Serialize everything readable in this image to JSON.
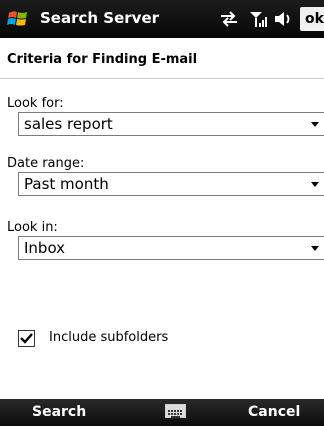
{
  "titlebar": {
    "app_title": "Search Server",
    "ok_label": "ok",
    "icons": [
      "windows-logo",
      "data-connection",
      "signal-strength",
      "speaker"
    ]
  },
  "header": {
    "title": "Criteria for Finding E-mail"
  },
  "form": {
    "look_for_label": "Look for:",
    "look_for_value": "sales report",
    "date_range_label": "Date range:",
    "date_range_value": "Past month",
    "look_in_label": "Look in:",
    "look_in_value": "Inbox",
    "include_subfolders_label": "Include subfolders",
    "include_subfolders_checked": true
  },
  "softkeys": {
    "left": "Search",
    "right": "Cancel",
    "center_icon": "keyboard"
  },
  "colors": {
    "titlebar": "#0b0b0b",
    "softbar": "#111111"
  }
}
